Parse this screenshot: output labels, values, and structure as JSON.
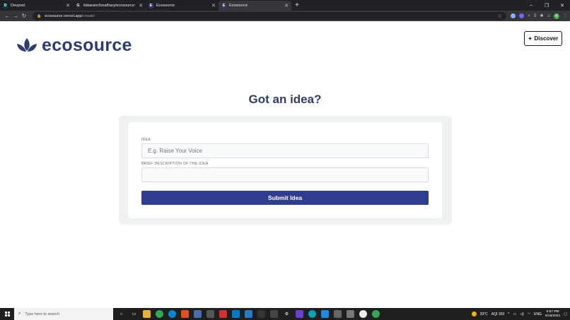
{
  "browser": {
    "tabs": [
      {
        "title": "Devpost",
        "favicon": "D",
        "favicon_color": "#003e54",
        "active": false
      },
      {
        "title": "itskaranchoudhary/ecosource: Ec",
        "favicon": "G",
        "favicon_color": "#24292e",
        "active": false
      },
      {
        "title": "Ecosource",
        "favicon": "E",
        "favicon_color": "#2f3c6e",
        "active": false
      },
      {
        "title": "Ecosource",
        "favicon": "E",
        "favicon_color": "#2f3c6e",
        "active": true
      }
    ],
    "new_tab": "+",
    "address": {
      "domain": "ecosource.vercel.app",
      "path": "/create/"
    },
    "extension_badge": "5",
    "profile_initial": "K",
    "window_controls": {
      "minimize": "–",
      "maximize": "❐",
      "close": "✕"
    }
  },
  "site": {
    "logo_text": "ecosource",
    "discover_label": "Discover",
    "heading": "Got an idea?"
  },
  "form": {
    "idea_label": "IDEA",
    "idea_placeholder": "E.g. Raise Your Voice",
    "idea_value": "",
    "description_label": "BRIEF DESCRIPTION OF THE IDEA",
    "description_value": "",
    "submit_label": "Submit Idea"
  },
  "taskbar": {
    "search_placeholder": "Type here to search",
    "weather": "33°C",
    "aqi": "AQI 109",
    "lang": "ENG",
    "time": "6:57 PM",
    "date": "8/15/2021"
  },
  "colors": {
    "brand": "#2f3c6e",
    "button": "#2f3d8e",
    "card_bg": "#eef3f1"
  }
}
